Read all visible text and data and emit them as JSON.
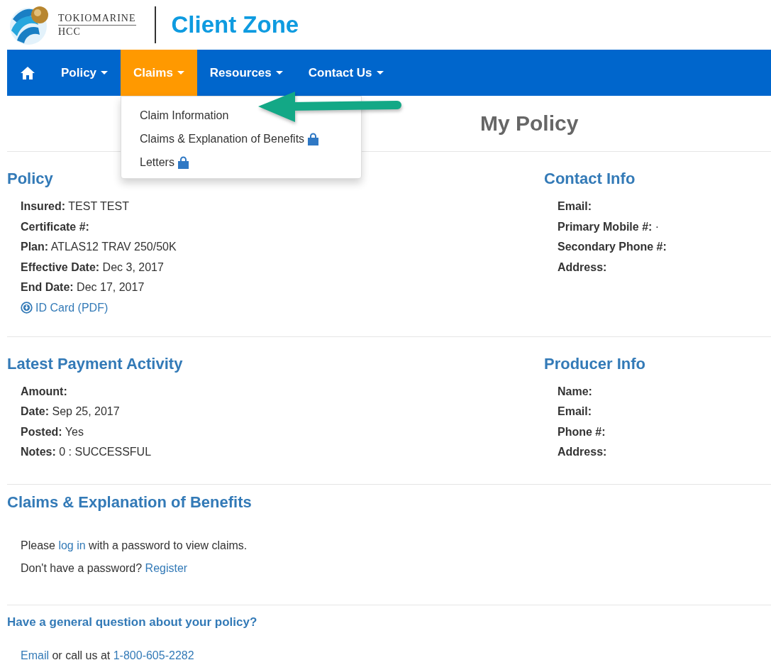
{
  "header": {
    "brand_lines": [
      "TOKIOMARINE",
      "HCC"
    ],
    "app_title": "Client Zone"
  },
  "nav": [
    {
      "kind": "home",
      "selected": false
    },
    {
      "kind": "menu",
      "label": "Policy",
      "selected": false
    },
    {
      "kind": "menu",
      "label": "Claims",
      "selected": true
    },
    {
      "kind": "menu",
      "label": "Resources",
      "selected": false
    },
    {
      "kind": "menu",
      "label": "Contact Us",
      "selected": false
    }
  ],
  "dropdown": [
    {
      "label": "Claim Information",
      "locked": false
    },
    {
      "label": "Claims & Explanation of Benefits",
      "locked": true
    },
    {
      "label": "Letters",
      "locked": true
    }
  ],
  "page_title": "My Policy",
  "section_rows": [
    [
      {
        "title": "Policy",
        "fields": [
          "**Insured:** TEST TEST",
          "**Certificate #:**",
          "**Plan:** ATLAS12 TRAV 250/50K",
          "**Effective Date:** Dec 3, 2017",
          "**End Date:** Dec 17, 2017"
        ],
        "link": "ID Card (PDF)"
      },
      {
        "title": "Contact Info",
        "fields": [
          "**Email:**",
          "**Primary Mobile #:** ·",
          "**Secondary Phone #:**",
          "**Address:**"
        ]
      }
    ],
    [
      {
        "title": "Latest Payment Activity",
        "fields": [
          "**Amount:**",
          "**Date:** Sep 25, 2017",
          "**Posted:** Yes",
          "**Notes:** 0 : SUCCESSFUL"
        ]
      },
      {
        "title": "Producer Info",
        "fields": [
          "**Name:**",
          "**Email:**",
          "**Phone #:**",
          "**Address:**"
        ]
      }
    ]
  ],
  "claims": {
    "title": "Claims & Explanation of Benefits",
    "lines": [
      [
        {
          "text": "Please "
        },
        {
          "link": "log in"
        },
        {
          "text": " with a password to view claims."
        }
      ],
      [
        {
          "text": "Don't have a password? "
        },
        {
          "link": "Register"
        }
      ]
    ]
  },
  "help": {
    "question": "Have a general question about your policy?",
    "lines": [
      [
        {
          "link": "Email"
        },
        {
          "text": " or call us at "
        },
        {
          "link": "1-800-605-2282"
        }
      ]
    ]
  }
}
